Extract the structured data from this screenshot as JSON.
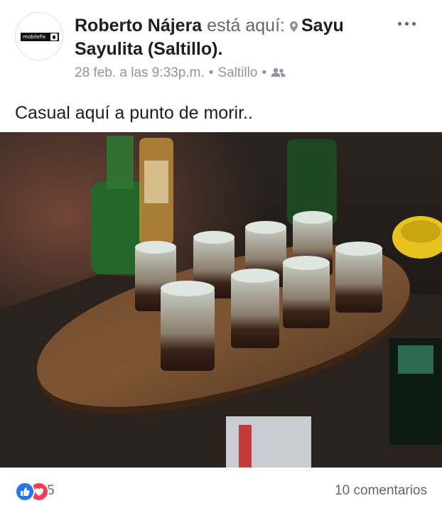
{
  "post": {
    "author": "Roberto Nájera",
    "action": "está aquí:",
    "place": "Sayu Sayulita (Saltillo)",
    "punct": ".",
    "date": "28 feb. a las 9:33p.m.",
    "city": "Saltillo",
    "privacy_icon": "friends-icon",
    "caption": "Casual aquí a punto de morir..",
    "avatar_text": "mobilefix"
  },
  "footer": {
    "reaction_count": "5",
    "comments": "10 comentarios",
    "reactions": [
      "like",
      "love"
    ]
  },
  "colors": {
    "like": "#2078f4",
    "love": "#f33e58",
    "meta_gray": "#90949c"
  }
}
